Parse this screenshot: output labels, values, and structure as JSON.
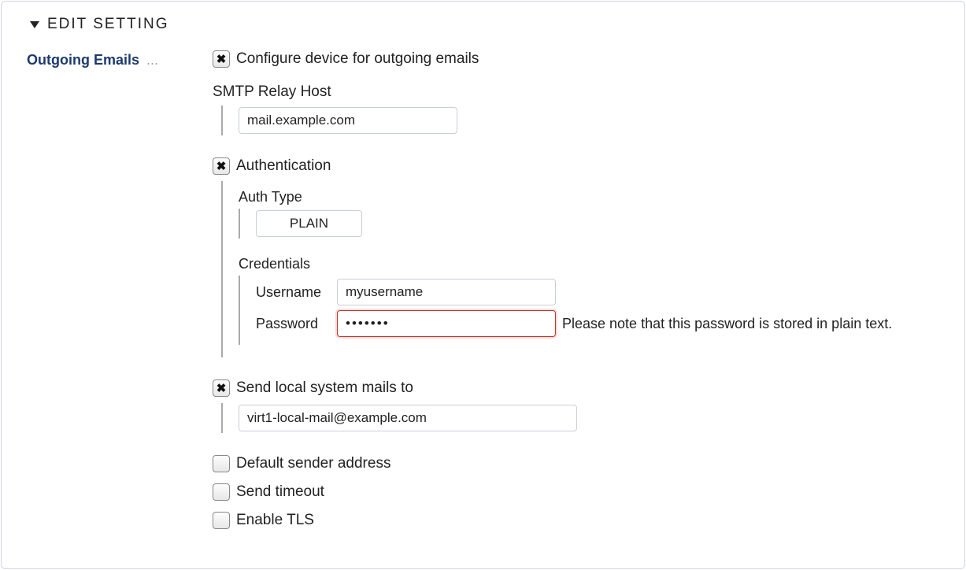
{
  "header": {
    "title": "EDIT SETTING"
  },
  "side": {
    "link_text": "Outgoing Emails",
    "ellipsis": "..."
  },
  "config": {
    "configure_label": "Configure device for outgoing emails",
    "smtp_relay_label": "SMTP Relay Host",
    "smtp_relay_value": "mail.example.com",
    "auth_label": "Authentication",
    "auth_type_label": "Auth Type",
    "auth_type_value": "PLAIN",
    "credentials_label": "Credentials",
    "username_label": "Username",
    "username_value": "myusername",
    "password_label": "Password",
    "password_value": "•••••••",
    "password_note": "Please note that this password is stored in plain text.",
    "send_local_label": "Send local system mails to",
    "send_local_value": "virt1-local-mail@example.com",
    "default_sender_label": "Default sender address",
    "send_timeout_label": "Send timeout",
    "enable_tls_label": "Enable TLS"
  }
}
